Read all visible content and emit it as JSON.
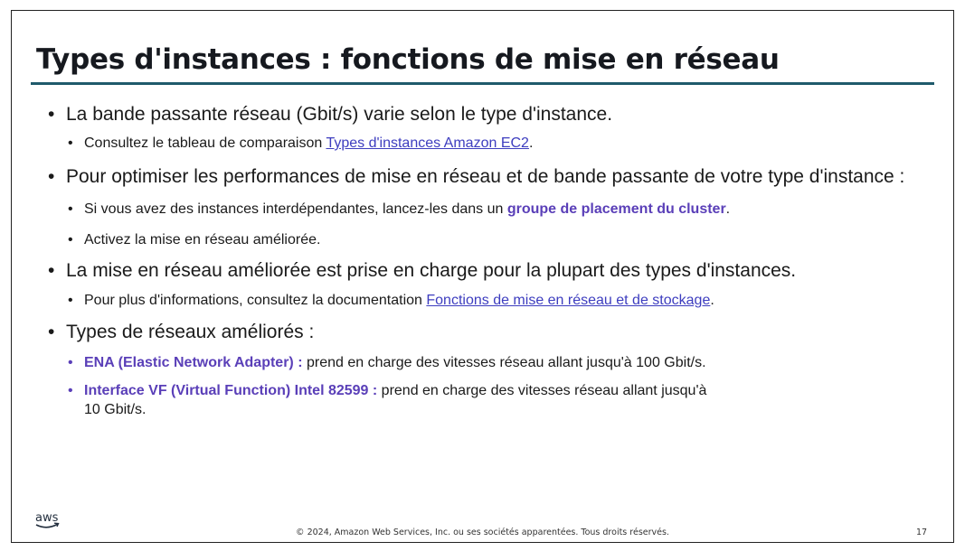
{
  "slide": {
    "title": "Types d'instances : fonctions de mise en réseau",
    "bullets": [
      {
        "text": "La bande passante réseau (Gbit/s) varie selon le type d'instance.",
        "sub": [
          {
            "before": "Consultez le tableau de comparaison ",
            "link": "Types d'instances Amazon EC2",
            "after": "."
          }
        ]
      },
      {
        "text": "Pour optimiser les performances de mise en réseau et de bande passante de votre type d'instance :",
        "sub": [
          {
            "before": "Si vous avez des instances interdépendantes, lancez-les dans un ",
            "highlight": "groupe de placement du cluster",
            "after": "."
          },
          {
            "text": "Activez la mise en réseau améliorée."
          }
        ]
      },
      {
        "text": "La mise en réseau améliorée est prise en charge pour la plupart des types d'instances.",
        "sub": [
          {
            "before": "Pour plus d'informations, consultez la documentation ",
            "link": "Fonctions de mise en réseau et de stockage",
            "after": "."
          }
        ]
      },
      {
        "text": "Types de réseaux améliorés :",
        "sub": [
          {
            "highlight": "ENA (Elastic Network Adapter) :",
            "after": " prend en charge des vitesses réseau allant jusqu'à 100 Gbit/s."
          },
          {
            "highlight": "Interface VF (Virtual Function) Intel 82599 :",
            "after_line1": " prend en charge des vitesses réseau allant jusqu'à",
            "after_line2": "10 Gbit/s."
          }
        ]
      }
    ]
  },
  "footer": {
    "logo_text": "aws",
    "copyright": "© 2024, Amazon Web Services, Inc. ou ses sociétés apparentées. Tous droits réservés.",
    "page_number": "17"
  },
  "colors": {
    "title_rule": "#1f5a6b",
    "link": "#3d3dbf",
    "highlight": "#5a3fb8"
  }
}
